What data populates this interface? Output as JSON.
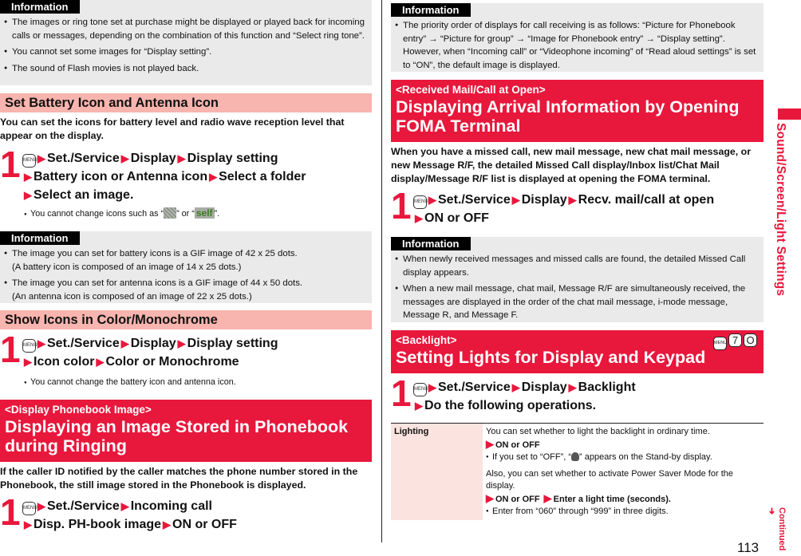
{
  "left": {
    "info1": {
      "tag": "Information",
      "items": [
        "The images or ring tone set at purchase might be displayed or played back for incoming calls or messages, depending on the combination of this function and “Select ring tone”.",
        "You cannot set some images for “Display setting”.",
        "The sound of Flash movies is not played back."
      ]
    },
    "battery": {
      "heading": "Set Battery Icon and Antenna Icon",
      "lead": "You can set the icons for battery level and radio wave reception level that appear on the display.",
      "step_num": "1",
      "menu_key": "MENU",
      "path": [
        "Set./Service",
        "Display",
        "Display setting",
        "Battery icon or Antenna icon",
        "Select a folder",
        "Select an image."
      ],
      "note_pre": "You cannot change icons such as “",
      "note_mid": "” or “",
      "note_self": "self",
      "note_post": "”."
    },
    "info2": {
      "tag": "Information",
      "items": [
        {
          "main": "The image you can set for battery icons is a GIF image of 42 x 25 dots.",
          "sub": "(A battery icon is composed of an image of 14 x 25 dots.)"
        },
        {
          "main": "The image you can set for antenna icons is a GIF image of 44 x 50 dots.",
          "sub": "(An antenna icon is composed of an image of 22 x 25 dots.)"
        }
      ]
    },
    "color": {
      "heading": "Show Icons in Color/Monochrome",
      "step_num": "1",
      "menu_key": "MENU",
      "path": [
        "Set./Service",
        "Display",
        "Display setting",
        "Icon color",
        "Color or Monochrome"
      ],
      "note": "You cannot change the battery icon and antenna icon."
    },
    "phonebook": {
      "sub": "<Display Phonebook Image>",
      "title_line1": "Displaying an Image Stored in Phonebook",
      "title_line2": "during Ringing",
      "lead": "If the caller ID notified by the caller matches the phone number stored in the Phonebook, the still image stored in the Phonebook is displayed.",
      "step_num": "1",
      "menu_key": "MENU",
      "path": [
        "Set./Service",
        "Incoming call",
        "Disp. PH-book image",
        "ON or OFF"
      ]
    }
  },
  "right": {
    "info1": {
      "tag": "Information",
      "items": [
        "The priority order of displays for call receiving is as follows: “Picture for Phonebook entry” → “Picture for group” → “Image for Phonebook entry” → “Display setting”. However, when “Incoming call” or “Videophone incoming” of “Read aloud settings” is set to “ON”, the default image is displayed."
      ]
    },
    "arrival": {
      "sub": "<Received Mail/Call at Open>",
      "title_line1": "Displaying Arrival Information by Opening",
      "title_line2": "FOMA Terminal",
      "lead": "When you have a missed call, new mail message, new chat mail message, or new Message R/F, the detailed Missed Call display/Inbox list/Chat Mail display/Message R/F list is displayed at opening the FOMA terminal.",
      "step_num": "1",
      "menu_key": "MENU",
      "path": [
        "Set./Service",
        "Display",
        "Recv. mail/call at open",
        "ON or OFF"
      ]
    },
    "info2": {
      "tag": "Information",
      "items": [
        "When newly received messages and missed calls are found, the detailed Missed Call display appears.",
        "When a new mail message, chat mail, Message R/F are simultaneously received, the messages are displayed in the order of the chat mail message, i-mode message, Message R, and Message F."
      ]
    },
    "backlight": {
      "sub": "<Backlight>",
      "title": "Setting Lights for Display and Keypad",
      "shortcut_keys": [
        "MENU",
        "7",
        "O"
      ],
      "step_num": "1",
      "menu_key": "MENU",
      "path": [
        "Set./Service",
        "Display",
        "Backlight",
        "Do the following operations."
      ],
      "table": {
        "label": "Lighting",
        "line1": "You can set whether to light the backlight in ordinary time.",
        "opt1": "ON or OFF",
        "bullet1_pre": "If you set to “OFF”, “",
        "bullet1_post": "” appears on the Stand-by display.",
        "line2": "Also, you can set whether to activate Power Saver Mode for the display.",
        "opt2a": "ON or OFF",
        "opt2b": "Enter a light time (seconds).",
        "bullet2": "Enter from “060” through “999” in three digits."
      }
    }
  },
  "side_label": "Sound/Screen/Light Settings",
  "page_number": "113",
  "continued": "Continued",
  "colors": {
    "accent_red": "#e8173c",
    "pink_bar": "#f8b4ae",
    "info_bg": "#eaeaea",
    "table_label_bg": "#fbe3df"
  }
}
